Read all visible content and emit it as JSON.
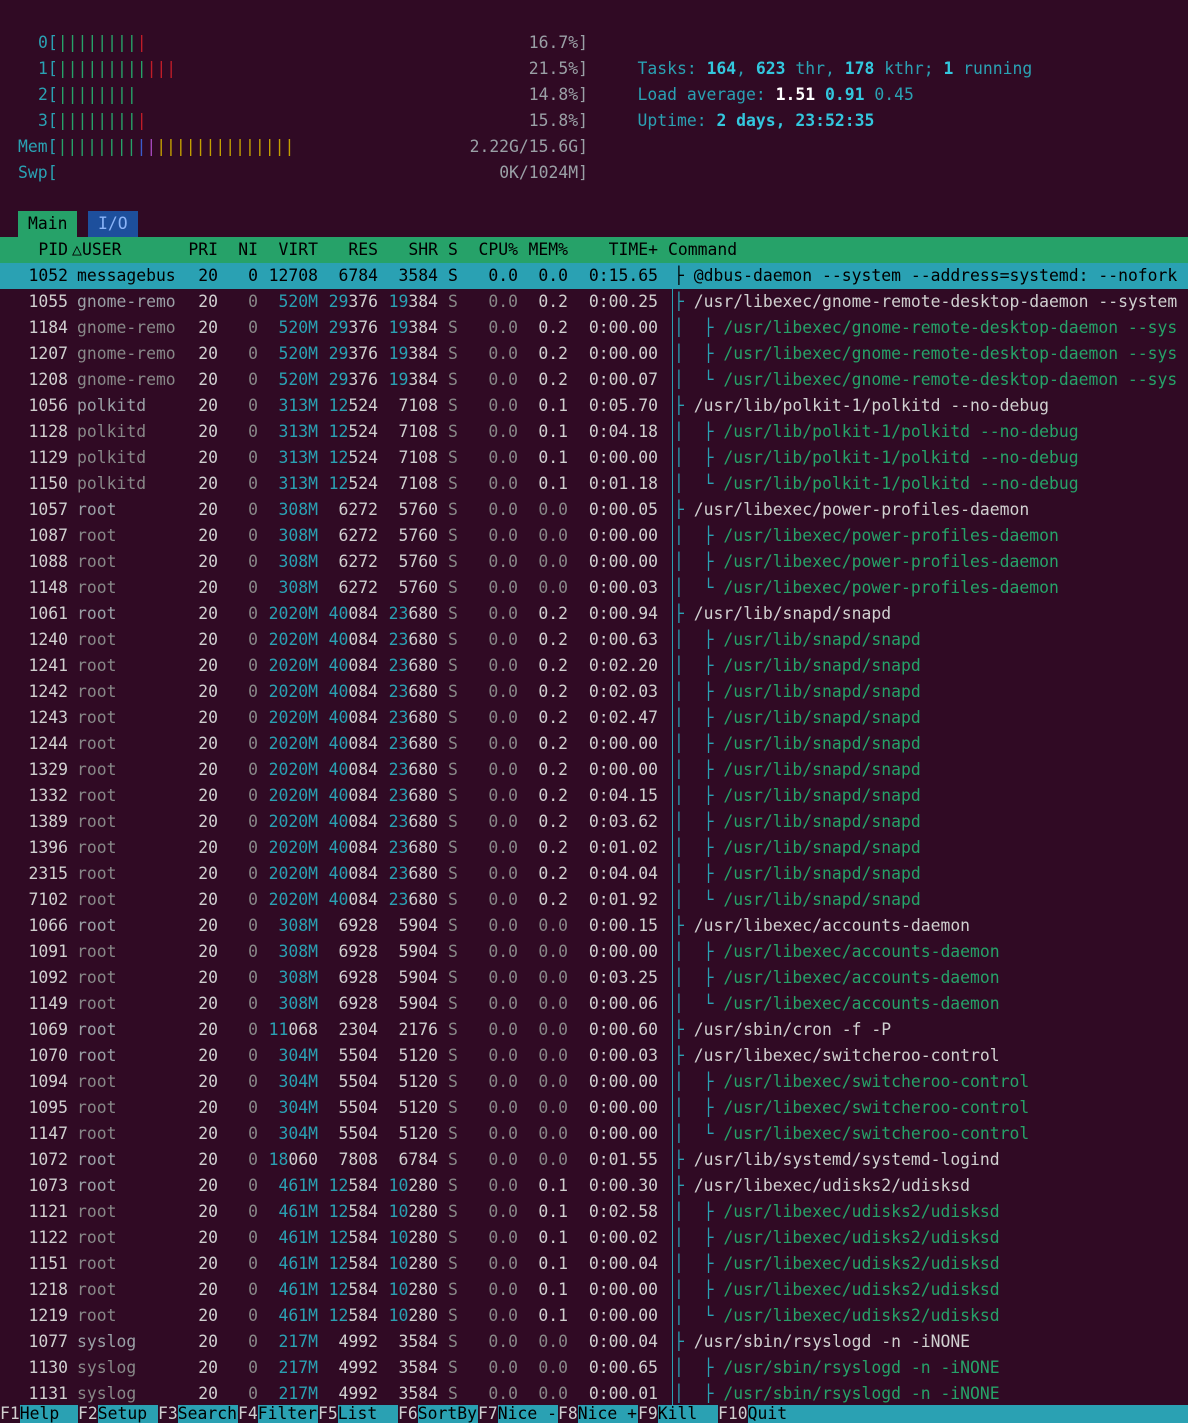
{
  "meters": {
    "cpus": [
      {
        "label": "0[",
        "bars": "||||||||",
        "red": "|",
        "value": "16.7%]"
      },
      {
        "label": "1[",
        "bars": "|||||||||",
        "red": "|||",
        "value": "21.5%]"
      },
      {
        "label": "2[",
        "bars": "||||||||",
        "red": "",
        "value": "14.8%]"
      },
      {
        "label": "3[",
        "bars": "||||||||",
        "red": "|",
        "value": "15.8%]"
      }
    ],
    "mem": {
      "label": "Mem[",
      "green": "||||||||",
      "blue": "|",
      "mag": "|",
      "yellow": "||||||||||||||",
      "value": "2.22G/15.6G]"
    },
    "swp": {
      "label": "Swp[",
      "value": "0K/1024M]"
    }
  },
  "summary": {
    "tasks_label": "Tasks: ",
    "tasks": "164",
    "thr_sep": ", ",
    "thr": "623",
    "thr_label": " thr, ",
    "kthr": "178",
    "kthr_label": " kthr; ",
    "running": "1",
    "running_label": " running",
    "load_label": "Load average: ",
    "load1": "1.51",
    "load5": "0.91",
    "load15": "0.45",
    "uptime_label": "Uptime: ",
    "uptime": "2 days, 23:52:35"
  },
  "tabs": {
    "main": "Main",
    "io": "I/O"
  },
  "columns": {
    "pid": "PID",
    "user": "USER",
    "pri": "PRI",
    "ni": "NI",
    "virt": "VIRT",
    "res": "RES",
    "shr": "SHR",
    "s": "S",
    "cpu": "CPU%",
    "mem": "MEM%",
    "time": "TIME+",
    "command": "Command"
  },
  "processes": [
    {
      "pid": "1052",
      "user": "messagebus",
      "pri": "20",
      "ni": "0",
      "virt": "12708",
      "res": "6784",
      "shr": "3584",
      "s": "S",
      "cpu": "0.0",
      "mem": "0.0",
      "time": "0:15.65",
      "tree": "├ ",
      "cmd": "@dbus-daemon --system --address=systemd: --nofork",
      "sel": true,
      "thread": false
    },
    {
      "pid": "1055",
      "user": "gnome-remo",
      "pri": "20",
      "ni": "0",
      "virt": "520M",
      "res": "29376",
      "shr": "19384",
      "s": "S",
      "cpu": "0.0",
      "mem": "0.2",
      "time": "0:00.25",
      "tree": "├ ",
      "cmd": "/usr/libexec/gnome-remote-desktop-daemon --system",
      "thread": false
    },
    {
      "pid": "1184",
      "user": "gnome-remo",
      "pri": "20",
      "ni": "0",
      "virt": "520M",
      "res": "29376",
      "shr": "19384",
      "s": "S",
      "cpu": "0.0",
      "mem": "0.2",
      "time": "0:00.00",
      "tree": "│  ├ ",
      "cmd": "/usr/libexec/gnome-remote-desktop-daemon --sys",
      "thread": true
    },
    {
      "pid": "1207",
      "user": "gnome-remo",
      "pri": "20",
      "ni": "0",
      "virt": "520M",
      "res": "29376",
      "shr": "19384",
      "s": "S",
      "cpu": "0.0",
      "mem": "0.2",
      "time": "0:00.00",
      "tree": "│  ├ ",
      "cmd": "/usr/libexec/gnome-remote-desktop-daemon --sys",
      "thread": true
    },
    {
      "pid": "1208",
      "user": "gnome-remo",
      "pri": "20",
      "ni": "0",
      "virt": "520M",
      "res": "29376",
      "shr": "19384",
      "s": "S",
      "cpu": "0.0",
      "mem": "0.2",
      "time": "0:00.07",
      "tree": "│  └ ",
      "cmd": "/usr/libexec/gnome-remote-desktop-daemon --sys",
      "thread": true
    },
    {
      "pid": "1056",
      "user": "polkitd",
      "pri": "20",
      "ni": "0",
      "virt": "313M",
      "res": "12524",
      "shr": "7108",
      "s": "S",
      "cpu": "0.0",
      "mem": "0.1",
      "time": "0:05.70",
      "tree": "├ ",
      "cmd": "/usr/lib/polkit-1/polkitd --no-debug",
      "thread": false
    },
    {
      "pid": "1128",
      "user": "polkitd",
      "pri": "20",
      "ni": "0",
      "virt": "313M",
      "res": "12524",
      "shr": "7108",
      "s": "S",
      "cpu": "0.0",
      "mem": "0.1",
      "time": "0:04.18",
      "tree": "│  ├ ",
      "cmd": "/usr/lib/polkit-1/polkitd --no-debug",
      "thread": true
    },
    {
      "pid": "1129",
      "user": "polkitd",
      "pri": "20",
      "ni": "0",
      "virt": "313M",
      "res": "12524",
      "shr": "7108",
      "s": "S",
      "cpu": "0.0",
      "mem": "0.1",
      "time": "0:00.00",
      "tree": "│  ├ ",
      "cmd": "/usr/lib/polkit-1/polkitd --no-debug",
      "thread": true
    },
    {
      "pid": "1150",
      "user": "polkitd",
      "pri": "20",
      "ni": "0",
      "virt": "313M",
      "res": "12524",
      "shr": "7108",
      "s": "S",
      "cpu": "0.0",
      "mem": "0.1",
      "time": "0:01.18",
      "tree": "│  └ ",
      "cmd": "/usr/lib/polkit-1/polkitd --no-debug",
      "thread": true
    },
    {
      "pid": "1057",
      "user": "root",
      "pri": "20",
      "ni": "0",
      "virt": "308M",
      "res": "6272",
      "shr": "5760",
      "s": "S",
      "cpu": "0.0",
      "mem": "0.0",
      "time": "0:00.05",
      "tree": "├ ",
      "cmd": "/usr/libexec/power-profiles-daemon",
      "thread": false
    },
    {
      "pid": "1087",
      "user": "root",
      "pri": "20",
      "ni": "0",
      "virt": "308M",
      "res": "6272",
      "shr": "5760",
      "s": "S",
      "cpu": "0.0",
      "mem": "0.0",
      "time": "0:00.00",
      "tree": "│  ├ ",
      "cmd": "/usr/libexec/power-profiles-daemon",
      "thread": true
    },
    {
      "pid": "1088",
      "user": "root",
      "pri": "20",
      "ni": "0",
      "virt": "308M",
      "res": "6272",
      "shr": "5760",
      "s": "S",
      "cpu": "0.0",
      "mem": "0.0",
      "time": "0:00.00",
      "tree": "│  ├ ",
      "cmd": "/usr/libexec/power-profiles-daemon",
      "thread": true
    },
    {
      "pid": "1148",
      "user": "root",
      "pri": "20",
      "ni": "0",
      "virt": "308M",
      "res": "6272",
      "shr": "5760",
      "s": "S",
      "cpu": "0.0",
      "mem": "0.0",
      "time": "0:00.03",
      "tree": "│  └ ",
      "cmd": "/usr/libexec/power-profiles-daemon",
      "thread": true
    },
    {
      "pid": "1061",
      "user": "root",
      "pri": "20",
      "ni": "0",
      "virt": "2020M",
      "res": "40084",
      "shr": "23680",
      "s": "S",
      "cpu": "0.0",
      "mem": "0.2",
      "time": "0:00.94",
      "tree": "├ ",
      "cmd": "/usr/lib/snapd/snapd",
      "thread": false
    },
    {
      "pid": "1240",
      "user": "root",
      "pri": "20",
      "ni": "0",
      "virt": "2020M",
      "res": "40084",
      "shr": "23680",
      "s": "S",
      "cpu": "0.0",
      "mem": "0.2",
      "time": "0:00.63",
      "tree": "│  ├ ",
      "cmd": "/usr/lib/snapd/snapd",
      "thread": true
    },
    {
      "pid": "1241",
      "user": "root",
      "pri": "20",
      "ni": "0",
      "virt": "2020M",
      "res": "40084",
      "shr": "23680",
      "s": "S",
      "cpu": "0.0",
      "mem": "0.2",
      "time": "0:02.20",
      "tree": "│  ├ ",
      "cmd": "/usr/lib/snapd/snapd",
      "thread": true
    },
    {
      "pid": "1242",
      "user": "root",
      "pri": "20",
      "ni": "0",
      "virt": "2020M",
      "res": "40084",
      "shr": "23680",
      "s": "S",
      "cpu": "0.0",
      "mem": "0.2",
      "time": "0:02.03",
      "tree": "│  ├ ",
      "cmd": "/usr/lib/snapd/snapd",
      "thread": true
    },
    {
      "pid": "1243",
      "user": "root",
      "pri": "20",
      "ni": "0",
      "virt": "2020M",
      "res": "40084",
      "shr": "23680",
      "s": "S",
      "cpu": "0.0",
      "mem": "0.2",
      "time": "0:02.47",
      "tree": "│  ├ ",
      "cmd": "/usr/lib/snapd/snapd",
      "thread": true
    },
    {
      "pid": "1244",
      "user": "root",
      "pri": "20",
      "ni": "0",
      "virt": "2020M",
      "res": "40084",
      "shr": "23680",
      "s": "S",
      "cpu": "0.0",
      "mem": "0.2",
      "time": "0:00.00",
      "tree": "│  ├ ",
      "cmd": "/usr/lib/snapd/snapd",
      "thread": true
    },
    {
      "pid": "1329",
      "user": "root",
      "pri": "20",
      "ni": "0",
      "virt": "2020M",
      "res": "40084",
      "shr": "23680",
      "s": "S",
      "cpu": "0.0",
      "mem": "0.2",
      "time": "0:00.00",
      "tree": "│  ├ ",
      "cmd": "/usr/lib/snapd/snapd",
      "thread": true
    },
    {
      "pid": "1332",
      "user": "root",
      "pri": "20",
      "ni": "0",
      "virt": "2020M",
      "res": "40084",
      "shr": "23680",
      "s": "S",
      "cpu": "0.0",
      "mem": "0.2",
      "time": "0:04.15",
      "tree": "│  ├ ",
      "cmd": "/usr/lib/snapd/snapd",
      "thread": true
    },
    {
      "pid": "1389",
      "user": "root",
      "pri": "20",
      "ni": "0",
      "virt": "2020M",
      "res": "40084",
      "shr": "23680",
      "s": "S",
      "cpu": "0.0",
      "mem": "0.2",
      "time": "0:03.62",
      "tree": "│  ├ ",
      "cmd": "/usr/lib/snapd/snapd",
      "thread": true
    },
    {
      "pid": "1396",
      "user": "root",
      "pri": "20",
      "ni": "0",
      "virt": "2020M",
      "res": "40084",
      "shr": "23680",
      "s": "S",
      "cpu": "0.0",
      "mem": "0.2",
      "time": "0:01.02",
      "tree": "│  ├ ",
      "cmd": "/usr/lib/snapd/snapd",
      "thread": true
    },
    {
      "pid": "2315",
      "user": "root",
      "pri": "20",
      "ni": "0",
      "virt": "2020M",
      "res": "40084",
      "shr": "23680",
      "s": "S",
      "cpu": "0.0",
      "mem": "0.2",
      "time": "0:04.04",
      "tree": "│  ├ ",
      "cmd": "/usr/lib/snapd/snapd",
      "thread": true
    },
    {
      "pid": "7102",
      "user": "root",
      "pri": "20",
      "ni": "0",
      "virt": "2020M",
      "res": "40084",
      "shr": "23680",
      "s": "S",
      "cpu": "0.0",
      "mem": "0.2",
      "time": "0:01.92",
      "tree": "│  └ ",
      "cmd": "/usr/lib/snapd/snapd",
      "thread": true
    },
    {
      "pid": "1066",
      "user": "root",
      "pri": "20",
      "ni": "0",
      "virt": "308M",
      "res": "6928",
      "shr": "5904",
      "s": "S",
      "cpu": "0.0",
      "mem": "0.0",
      "time": "0:00.15",
      "tree": "├ ",
      "cmd": "/usr/libexec/accounts-daemon",
      "thread": false
    },
    {
      "pid": "1091",
      "user": "root",
      "pri": "20",
      "ni": "0",
      "virt": "308M",
      "res": "6928",
      "shr": "5904",
      "s": "S",
      "cpu": "0.0",
      "mem": "0.0",
      "time": "0:00.00",
      "tree": "│  ├ ",
      "cmd": "/usr/libexec/accounts-daemon",
      "thread": true
    },
    {
      "pid": "1092",
      "user": "root",
      "pri": "20",
      "ni": "0",
      "virt": "308M",
      "res": "6928",
      "shr": "5904",
      "s": "S",
      "cpu": "0.0",
      "mem": "0.0",
      "time": "0:03.25",
      "tree": "│  ├ ",
      "cmd": "/usr/libexec/accounts-daemon",
      "thread": true
    },
    {
      "pid": "1149",
      "user": "root",
      "pri": "20",
      "ni": "0",
      "virt": "308M",
      "res": "6928",
      "shr": "5904",
      "s": "S",
      "cpu": "0.0",
      "mem": "0.0",
      "time": "0:00.06",
      "tree": "│  └ ",
      "cmd": "/usr/libexec/accounts-daemon",
      "thread": true
    },
    {
      "pid": "1069",
      "user": "root",
      "pri": "20",
      "ni": "0",
      "virt": "11068",
      "res": "2304",
      "shr": "2176",
      "s": "S",
      "cpu": "0.0",
      "mem": "0.0",
      "time": "0:00.60",
      "tree": "├ ",
      "cmd": "/usr/sbin/cron -f -P",
      "thread": false
    },
    {
      "pid": "1070",
      "user": "root",
      "pri": "20",
      "ni": "0",
      "virt": "304M",
      "res": "5504",
      "shr": "5120",
      "s": "S",
      "cpu": "0.0",
      "mem": "0.0",
      "time": "0:00.03",
      "tree": "├ ",
      "cmd": "/usr/libexec/switcheroo-control",
      "thread": false
    },
    {
      "pid": "1094",
      "user": "root",
      "pri": "20",
      "ni": "0",
      "virt": "304M",
      "res": "5504",
      "shr": "5120",
      "s": "S",
      "cpu": "0.0",
      "mem": "0.0",
      "time": "0:00.00",
      "tree": "│  ├ ",
      "cmd": "/usr/libexec/switcheroo-control",
      "thread": true
    },
    {
      "pid": "1095",
      "user": "root",
      "pri": "20",
      "ni": "0",
      "virt": "304M",
      "res": "5504",
      "shr": "5120",
      "s": "S",
      "cpu": "0.0",
      "mem": "0.0",
      "time": "0:00.00",
      "tree": "│  ├ ",
      "cmd": "/usr/libexec/switcheroo-control",
      "thread": true
    },
    {
      "pid": "1147",
      "user": "root",
      "pri": "20",
      "ni": "0",
      "virt": "304M",
      "res": "5504",
      "shr": "5120",
      "s": "S",
      "cpu": "0.0",
      "mem": "0.0",
      "time": "0:00.00",
      "tree": "│  └ ",
      "cmd": "/usr/libexec/switcheroo-control",
      "thread": true
    },
    {
      "pid": "1072",
      "user": "root",
      "pri": "20",
      "ni": "0",
      "virt": "18060",
      "res": "7808",
      "shr": "6784",
      "s": "S",
      "cpu": "0.0",
      "mem": "0.0",
      "time": "0:01.55",
      "tree": "├ ",
      "cmd": "/usr/lib/systemd/systemd-logind",
      "thread": false
    },
    {
      "pid": "1073",
      "user": "root",
      "pri": "20",
      "ni": "0",
      "virt": "461M",
      "res": "12584",
      "shr": "10280",
      "s": "S",
      "cpu": "0.0",
      "mem": "0.1",
      "time": "0:00.30",
      "tree": "├ ",
      "cmd": "/usr/libexec/udisks2/udisksd",
      "thread": false
    },
    {
      "pid": "1121",
      "user": "root",
      "pri": "20",
      "ni": "0",
      "virt": "461M",
      "res": "12584",
      "shr": "10280",
      "s": "S",
      "cpu": "0.0",
      "mem": "0.1",
      "time": "0:02.58",
      "tree": "│  ├ ",
      "cmd": "/usr/libexec/udisks2/udisksd",
      "thread": true
    },
    {
      "pid": "1122",
      "user": "root",
      "pri": "20",
      "ni": "0",
      "virt": "461M",
      "res": "12584",
      "shr": "10280",
      "s": "S",
      "cpu": "0.0",
      "mem": "0.1",
      "time": "0:00.02",
      "tree": "│  ├ ",
      "cmd": "/usr/libexec/udisks2/udisksd",
      "thread": true
    },
    {
      "pid": "1151",
      "user": "root",
      "pri": "20",
      "ni": "0",
      "virt": "461M",
      "res": "12584",
      "shr": "10280",
      "s": "S",
      "cpu": "0.0",
      "mem": "0.1",
      "time": "0:00.04",
      "tree": "│  ├ ",
      "cmd": "/usr/libexec/udisks2/udisksd",
      "thread": true
    },
    {
      "pid": "1218",
      "user": "root",
      "pri": "20",
      "ni": "0",
      "virt": "461M",
      "res": "12584",
      "shr": "10280",
      "s": "S",
      "cpu": "0.0",
      "mem": "0.1",
      "time": "0:00.00",
      "tree": "│  ├ ",
      "cmd": "/usr/libexec/udisks2/udisksd",
      "thread": true
    },
    {
      "pid": "1219",
      "user": "root",
      "pri": "20",
      "ni": "0",
      "virt": "461M",
      "res": "12584",
      "shr": "10280",
      "s": "S",
      "cpu": "0.0",
      "mem": "0.1",
      "time": "0:00.00",
      "tree": "│  └ ",
      "cmd": "/usr/libexec/udisks2/udisksd",
      "thread": true
    },
    {
      "pid": "1077",
      "user": "syslog",
      "pri": "20",
      "ni": "0",
      "virt": "217M",
      "res": "4992",
      "shr": "3584",
      "s": "S",
      "cpu": "0.0",
      "mem": "0.0",
      "time": "0:00.04",
      "tree": "├ ",
      "cmd": "/usr/sbin/rsyslogd -n -iNONE",
      "thread": false
    },
    {
      "pid": "1130",
      "user": "syslog",
      "pri": "20",
      "ni": "0",
      "virt": "217M",
      "res": "4992",
      "shr": "3584",
      "s": "S",
      "cpu": "0.0",
      "mem": "0.0",
      "time": "0:00.65",
      "tree": "│  ├ ",
      "cmd": "/usr/sbin/rsyslogd -n -iNONE",
      "thread": true
    },
    {
      "pid": "1131",
      "user": "syslog",
      "pri": "20",
      "ni": "0",
      "virt": "217M",
      "res": "4992",
      "shr": "3584",
      "s": "S",
      "cpu": "0.0",
      "mem": "0.0",
      "time": "0:00.01",
      "tree": "│  ├ ",
      "cmd": "/usr/sbin/rsyslogd -n -iNONE",
      "thread": true
    }
  ],
  "fkeys": [
    {
      "key": "F1",
      "label": "Help"
    },
    {
      "key": "F2",
      "label": "Setup"
    },
    {
      "key": "F3",
      "label": "Search"
    },
    {
      "key": "F4",
      "label": "Filter"
    },
    {
      "key": "F5",
      "label": "List"
    },
    {
      "key": "F6",
      "label": "SortBy"
    },
    {
      "key": "F7",
      "label": "Nice -"
    },
    {
      "key": "F8",
      "label": "Nice +"
    },
    {
      "key": "F9",
      "label": "Kill"
    },
    {
      "key": "F10",
      "label": "Quit"
    }
  ]
}
